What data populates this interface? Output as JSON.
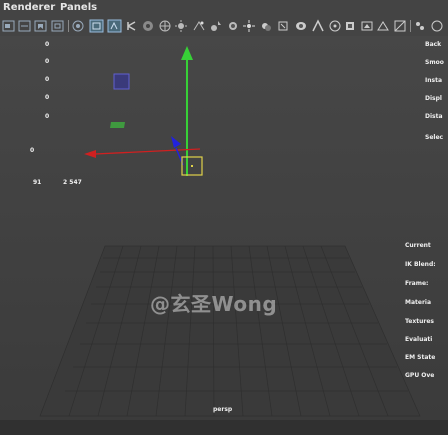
{
  "menu": {
    "renderer": "Renderer",
    "panels": "Panels"
  },
  "toolbar": {
    "icons": [
      "camera-select-icon",
      "camera-attrs-icon",
      "bookmark-icon",
      "image-plane-icon",
      "grid-toggle-icon",
      "film-gate-icon",
      "resolution-gate-icon",
      "gate-mask-icon",
      "field-chart-icon",
      "safe-action-icon",
      "wireframe-icon",
      "smooth-shade-icon",
      "default-material-icon",
      "textured-icon",
      "lighting-icon",
      "shadows-icon",
      "ambient-occlusion-icon",
      "motion-blur-icon",
      "anti-alias-icon",
      "depth-of-field-icon",
      "isolate-select-icon",
      "xray-icon",
      "xray-joints-icon",
      "backface-icon",
      "panel-layout-icon",
      "tear-off-icon",
      "more-icon"
    ]
  },
  "hud": {
    "stats": [
      {
        "value": "0"
      },
      {
        "value": "0"
      },
      {
        "value": "0"
      },
      {
        "value": "0"
      },
      {
        "value": "0"
      }
    ],
    "right_labels": [
      "Back",
      "Smoo",
      "Insta",
      "Displ",
      "Dista",
      "Selec"
    ],
    "stat_zero": "0",
    "frame_start": "91",
    "frame_value": "2 547",
    "info_labels": [
      "Current",
      "IK Blend:",
      "Frame:",
      "Materia",
      "Textures",
      "Evaluati",
      "EM State",
      "GPU Ove"
    ]
  },
  "camera": {
    "name": "persp"
  },
  "watermark": {
    "text": "@玄圣Wong"
  },
  "colors": {
    "viewport_top": "#474747",
    "viewport_bottom": "#3b3b3b",
    "grid": "#2e2e2e",
    "axis_y": "#37d137",
    "axis_x": "#d02020",
    "axis_z": "#2222dd",
    "manip_yellow": "#e0d24a"
  }
}
